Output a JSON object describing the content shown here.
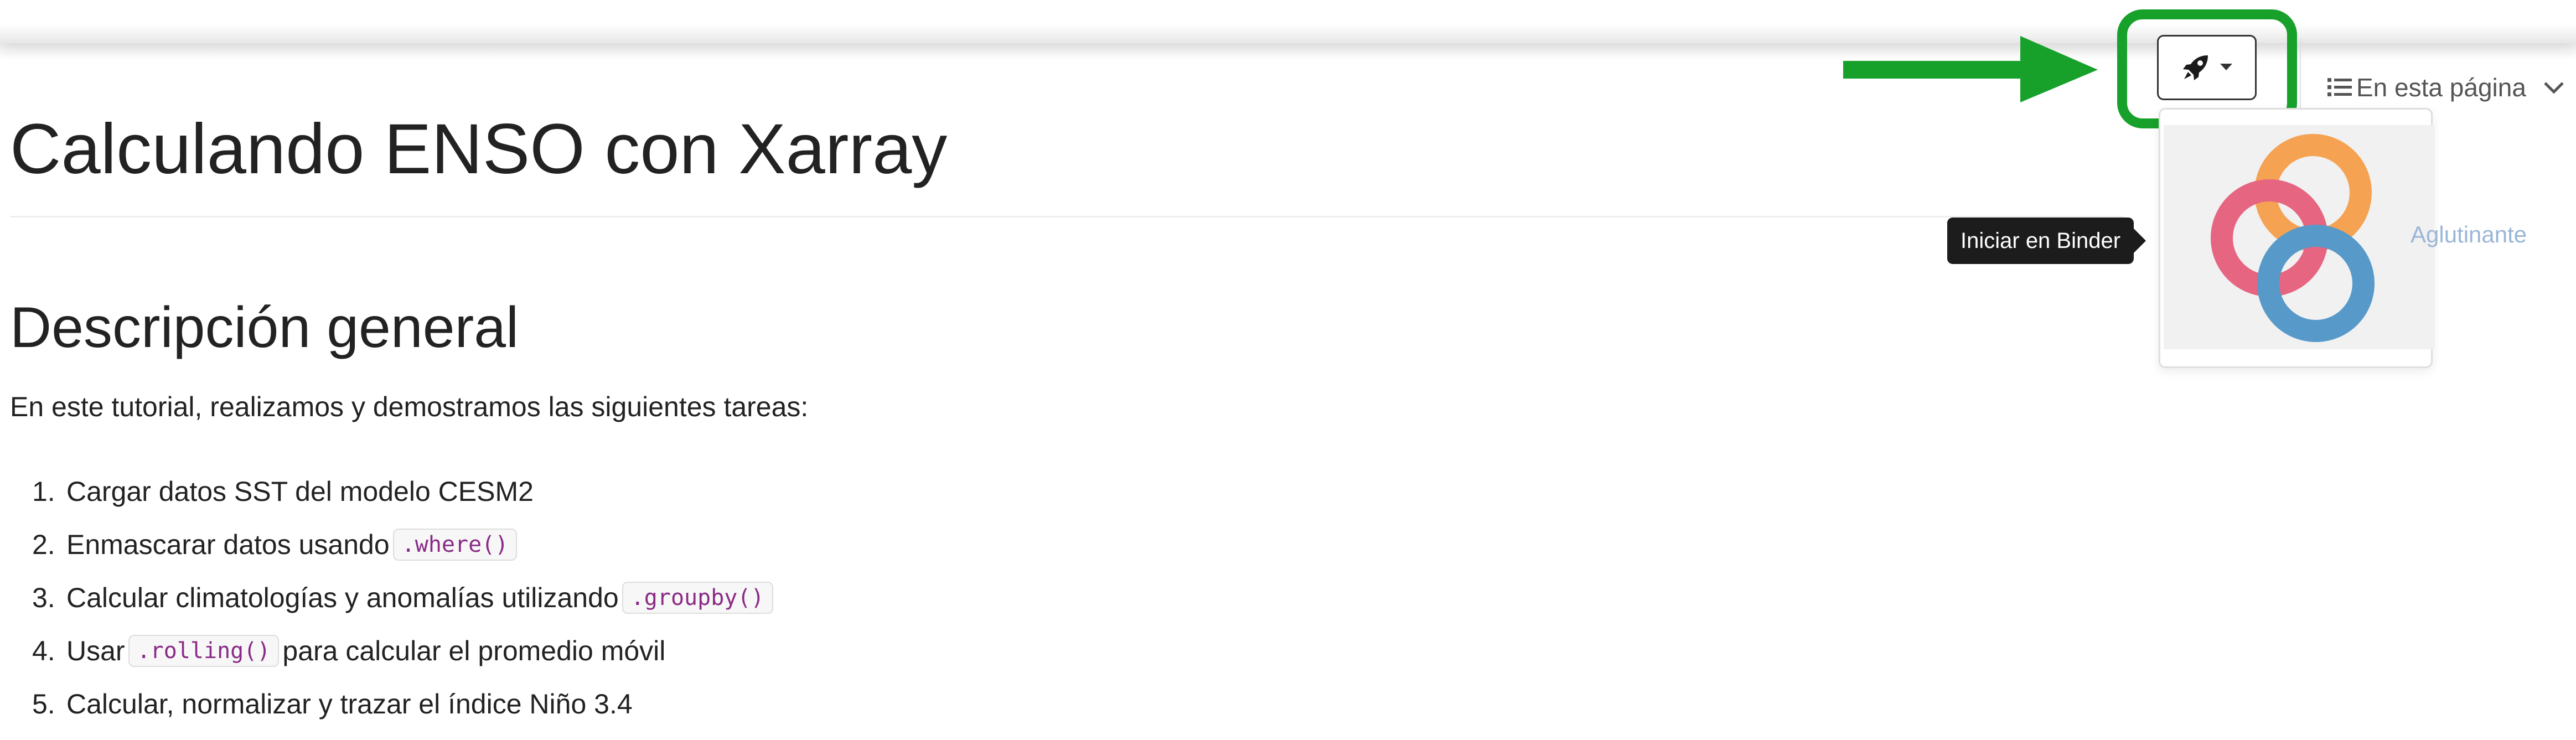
{
  "page": {
    "title": "Calculando ENSO con Xarray"
  },
  "overview": {
    "heading": "Descripción general",
    "intro": "En este tutorial, realizamos y demostramos las siguientes tareas:",
    "tasks": [
      {
        "num": "1.",
        "before": "Cargar datos SST del modelo CESM2",
        "code": "",
        "after": ""
      },
      {
        "num": "2.",
        "before": "Enmascarar datos usando",
        "code": ".where()",
        "after": ""
      },
      {
        "num": "3.",
        "before": "Calcular climatologías y anomalías utilizando",
        "code": ".groupby()",
        "after": ""
      },
      {
        "num": "4.",
        "before": "Usar ",
        "code": ".rolling()",
        "after": "para calcular el promedio móvil"
      },
      {
        "num": "5.",
        "before": "Calcular, normalizar y trazar el índice Niño 3.4",
        "code": "",
        "after": ""
      }
    ]
  },
  "launch_menu": {
    "button_icon": "rocket-icon",
    "binder_label": "Aglutinante",
    "tooltip": "Iniciar en Binder"
  },
  "toc": {
    "label": "En esta página",
    "icon": "list-icon"
  },
  "colors": {
    "highlight": "#17a12b",
    "code_text": "#8a2a86",
    "binder_orange": "#f5a252",
    "binder_pink": "#e66581",
    "binder_blue": "#579aca",
    "binder_label": "#9ab6d6"
  }
}
